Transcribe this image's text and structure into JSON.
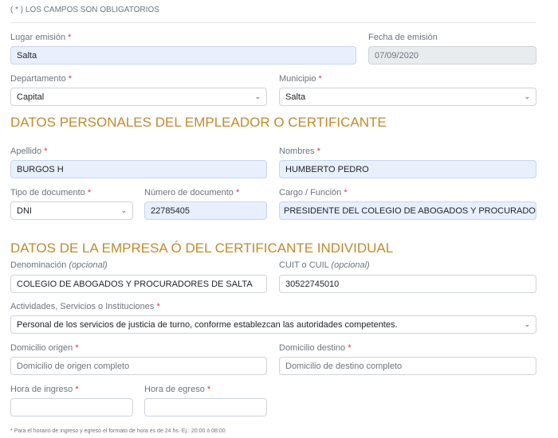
{
  "notice": "( * ) LOS CAMPOS SON OBLIGATORIOS",
  "required_mark": "*",
  "fields": {
    "lugar": {
      "label": "Lugar emisión",
      "value": "Salta"
    },
    "fecha": {
      "label": "Fecha de emisión",
      "value": "07/09/2020"
    },
    "departamento": {
      "label": "Departamento",
      "value": "Capital"
    },
    "municipio": {
      "label": "Municipio",
      "value": "Salta"
    },
    "apellido": {
      "label": "Apellido",
      "value": "BURGOS H"
    },
    "nombres": {
      "label": "Nombres",
      "value": "HUMBERTO PEDRO"
    },
    "tipo_doc": {
      "label": "Tipo de documento",
      "value": "DNI"
    },
    "num_doc": {
      "label": "Número de documento",
      "value": "22785405"
    },
    "cargo": {
      "label": "Cargo / Función",
      "value": "PRESIDENTE DEL COLEGIO DE ABOGADOS Y PROCURADORES DE SALTA"
    },
    "denominacion": {
      "label": "Denominación",
      "optional": "(opcional)",
      "value": "COLEGIO DE ABOGADOS Y PROCURADORES DE SALTA"
    },
    "cuit": {
      "label": "CUIT o CUIL",
      "optional": "(opcional)",
      "value": "30522745010"
    },
    "actividades": {
      "label": "Actividades, Servicios o Instituciones",
      "value": "Personal de los servicios de justicia de turno, conforme establezcan las autoridades competentes."
    },
    "dom_origen": {
      "label": "Domicilio origen",
      "placeholder": "Domicilio de origen completo"
    },
    "dom_destino": {
      "label": "Domicilio destino",
      "placeholder": "Domicilio de destino completo"
    },
    "hora_ingreso": {
      "label": "Hora de ingreso",
      "value": ""
    },
    "hora_egreso": {
      "label": "Hora de egreso",
      "value": ""
    }
  },
  "headings": {
    "personales": "DATOS PERSONALES DEL EMPLEADOR O CERTIFICANTE",
    "empresa": "DATOS DE LA EMPRESA Ó DEL CERTIFICANTE INDIVIDUAL"
  },
  "footnote": "* Para el horario de ingreso y egreso el formato de hora es de 24 hs. Ej.: 20:00 ó 08:00",
  "colors": {
    "heading": "#c08a2e",
    "required": "#dc3545",
    "autofill": "#e8f0fe"
  }
}
